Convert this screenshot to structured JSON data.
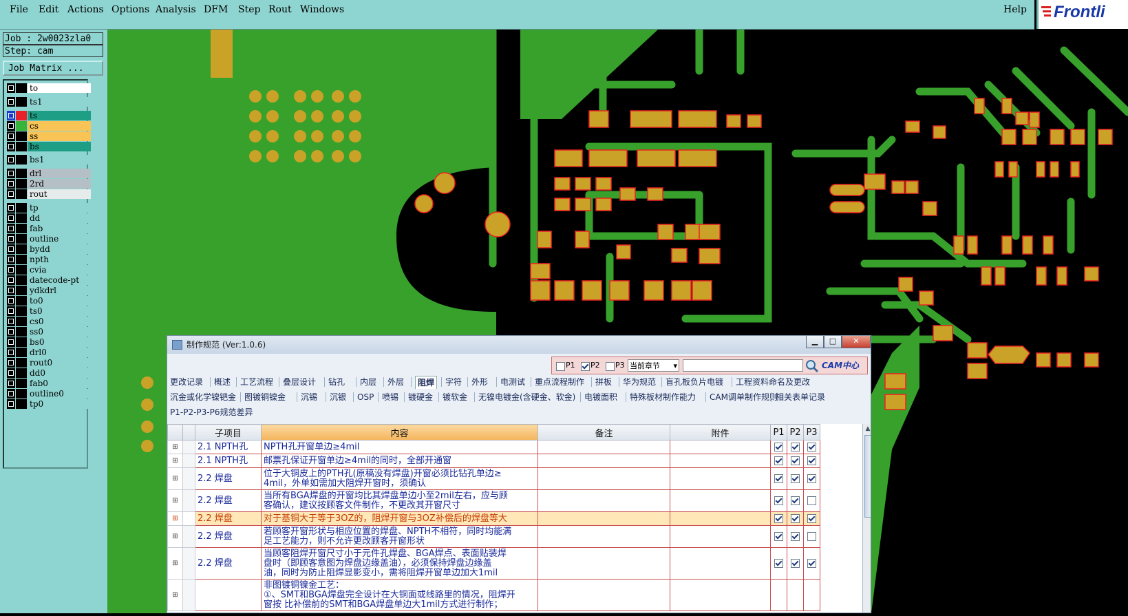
{
  "menu": [
    "File",
    "Edit",
    "Actions",
    "Options",
    "Analysis",
    "DFM",
    "Step",
    "Rout",
    "Windows"
  ],
  "help": "Help",
  "logo_text": "Frontli",
  "job": {
    "job_line": "Job : 2w0023zla0",
    "step_line": "Step: cam",
    "matrix_button": "Job Matrix ..."
  },
  "layers": [
    {
      "name": "to",
      "color": "#ffffff",
      "swatch": "#000000"
    },
    {
      "name": "ts1",
      "color": "#8ed4d0",
      "swatch": "#000000"
    },
    {
      "name": "ts",
      "color": "#1f9e86",
      "swatch": "#e8202a",
      "active": true
    },
    {
      "name": "cs",
      "color": "#f7c455",
      "swatch": "#37b43b"
    },
    {
      "name": "ss",
      "color": "#f7c455",
      "swatch": "#000000"
    },
    {
      "name": "bs",
      "color": "#1f9e86",
      "swatch": "#000000"
    },
    {
      "name": "bs1",
      "color": "#8ed4d0",
      "swatch": "#000000"
    },
    {
      "name": "drl",
      "color": "#b5bfc6",
      "swatch": "#000000"
    },
    {
      "name": "2rd",
      "color": "#b5bfc6",
      "swatch": "#000000"
    },
    {
      "name": "rout",
      "color": "#e6ecec",
      "swatch": "#000000"
    },
    {
      "name": "tp",
      "color": "#8ed4d0",
      "swatch": "#000000"
    },
    {
      "name": "dd",
      "color": "#8ed4d0",
      "swatch": "#000000"
    },
    {
      "name": "fab",
      "color": "#8ed4d0",
      "swatch": "#000000"
    },
    {
      "name": "outline",
      "color": "#8ed4d0",
      "swatch": "#000000"
    },
    {
      "name": "bydd",
      "color": "#8ed4d0",
      "swatch": "#000000"
    },
    {
      "name": "npth",
      "color": "#8ed4d0",
      "swatch": "#000000"
    },
    {
      "name": "cvia",
      "color": "#8ed4d0",
      "swatch": "#000000"
    },
    {
      "name": "datecode-pt",
      "color": "#8ed4d0",
      "swatch": "#000000"
    },
    {
      "name": "ydkdrl",
      "color": "#8ed4d0",
      "swatch": "#000000"
    },
    {
      "name": "to0",
      "color": "#8ed4d0",
      "swatch": "#000000"
    },
    {
      "name": "ts0",
      "color": "#8ed4d0",
      "swatch": "#000000"
    },
    {
      "name": "cs0",
      "color": "#8ed4d0",
      "swatch": "#000000"
    },
    {
      "name": "ss0",
      "color": "#8ed4d0",
      "swatch": "#000000"
    },
    {
      "name": "bs0",
      "color": "#8ed4d0",
      "swatch": "#000000"
    },
    {
      "name": "drl0",
      "color": "#8ed4d0",
      "swatch": "#000000"
    },
    {
      "name": "rout0",
      "color": "#8ed4d0",
      "swatch": "#000000"
    },
    {
      "name": "dd0",
      "color": "#8ed4d0",
      "swatch": "#000000"
    },
    {
      "name": "fab0",
      "color": "#8ed4d0",
      "swatch": "#000000"
    },
    {
      "name": "outline0",
      "color": "#8ed4d0",
      "swatch": "#000000"
    },
    {
      "name": "tp0",
      "color": "#8ed4d0",
      "swatch": "#000000"
    }
  ],
  "dialog": {
    "title": "制作规范 (Ver:1.0.6)",
    "filter": {
      "p1": "P1",
      "p2": "P2",
      "p3": "P3",
      "p1_checked": false,
      "p2_checked": true,
      "p3_checked": false,
      "scope": "当前章节",
      "search": ""
    },
    "cam_badge": "CAM中心",
    "tabs_row1": [
      "更改记录",
      "概述",
      "工艺流程",
      "叠层设计",
      "钻孔",
      "内层",
      "外层",
      "阻焊",
      "字符",
      "外形",
      "电测试",
      "重点流程制作",
      "拼板",
      "华为规范",
      "盲孔板负片电镀",
      "工程资料命名及更改"
    ],
    "active_tab": "阻焊",
    "tabs_row2": [
      "沉金或化学镍钯金",
      "图镀铜镍金",
      "沉锡",
      "沉银",
      "OSP",
      "喷锡",
      "镀硬金",
      "镀软金",
      "无镍电镀金(含硬金、软金)",
      "电镀面积",
      "特殊板材制作能力",
      "CAM调单制作规则",
      "相关表单记录"
    ],
    "tabs_row3": [
      "P1-P2-P3-P6规范差异"
    ],
    "columns": {
      "item": "子项目",
      "content": "内容",
      "note": "备注",
      "attach": "附件",
      "p1": "P1",
      "p2": "P2",
      "p3": "P3"
    },
    "rows": [
      {
        "item": "2.1 NPTH孔",
        "content": [
          "NPTH孔开窗单边≥4mil"
        ],
        "p1": true,
        "p2": true,
        "p3": true
      },
      {
        "item": "2.1 NPTH孔",
        "content": [
          "邮票孔保证开窗单边≥4mil的同时，全部开通窗"
        ],
        "p1": true,
        "p2": true,
        "p3": true
      },
      {
        "item": "2.2 焊盘",
        "content": [
          "位于大铜皮上的PTH孔(原稿没有焊盘)开窗必须比钻孔单边≥",
          "4mil，外单如需加大阻焊开窗时，须确认"
        ],
        "p1": true,
        "p2": true,
        "p3": true
      },
      {
        "item": "2.2 焊盘",
        "content": [
          "当所有BGA焊盘的开窗均比其焊盘单边小至2mil左右，应与顾",
          "客确认，建议按顾客文件制作，不更改其开窗尺寸"
        ],
        "p1": true,
        "p2": true,
        "p3": false
      },
      {
        "item": "2.2 焊盘",
        "content": [
          "对于基铜大于等于3OZ的，阻焊开窗与3OZ补偿后的焊盘等大"
        ],
        "p1": true,
        "p2": true,
        "p3": true,
        "highlight": true
      },
      {
        "item": "2.2 焊盘",
        "content": [
          "若顾客开窗形状与相应位置的焊盘、NPTH不相符，同时均能满",
          "足工艺能力，则不允许更改顾客开窗形状"
        ],
        "p1": true,
        "p2": true,
        "p3": false
      },
      {
        "item": "2.2 焊盘",
        "content": [
          "当顾客阻焊开窗尺寸小于元件孔焊盘、BGA焊点、表面贴装焊",
          "盘时（即顾客意图为焊盘边缘盖油），必须保持焊盘边缘盖",
          "油，同时为防止阻焊显影变小，需将阻焊开窗单边加大1mil"
        ],
        "p1": true,
        "p2": true,
        "p3": true
      },
      {
        "item": "",
        "content": [
          "非图镀铜镍金工艺：",
          "①、SMT和BGA焊盘完全设计在大铜面或线路里的情况，阻焊开",
          "窗按 比补偿前的SMT和BGA焊盘单边大1mil方式进行制作；"
        ],
        "p1": null,
        "p2": null,
        "p3": null
      }
    ]
  }
}
